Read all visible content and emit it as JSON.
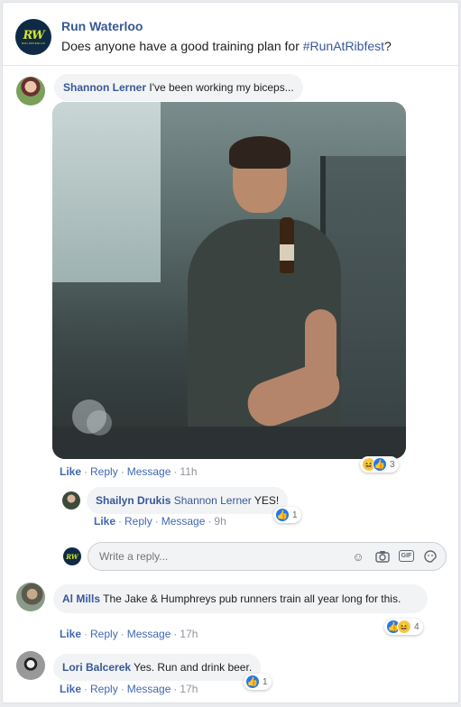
{
  "post": {
    "page_name": "Run Waterloo",
    "logo_main": "RW",
    "logo_sub": "RUN WATERLOO",
    "text_before": "Does anyone have a good training plan for ",
    "hashtag": "#RunAtRibfest",
    "text_after": "?"
  },
  "labels": {
    "like": "Like",
    "reply": "Reply",
    "message": "Message",
    "sep": "·"
  },
  "comments": [
    {
      "author": "Shannon Lerner",
      "text": "I've been working my biceps...",
      "time": "11h",
      "reaction_count": "3",
      "reply": {
        "author": "Shailyn Drukis",
        "mention": "Shannon Lerner",
        "text": "YES!",
        "time": "9h",
        "reaction_count": "1"
      }
    },
    {
      "author": "Al Mills",
      "text": "The Jake & Humphreys pub runners train all year long for this.",
      "time": "17h",
      "reaction_count": "4"
    },
    {
      "author": "Lori Balcerek",
      "text": "Yes. Run and drink beer.",
      "time": "17h",
      "reaction_count": "1"
    }
  ],
  "reply_box": {
    "placeholder": "Write a reply...",
    "icons": [
      "emoji-icon",
      "camera-icon",
      "gif-icon",
      "sticker-icon"
    ]
  },
  "colors": {
    "link": "#385898",
    "action": "#4267b2",
    "bubble": "#f2f3f5",
    "like_reaction": "#2078f4",
    "haha_reaction": "#f7c94b"
  }
}
